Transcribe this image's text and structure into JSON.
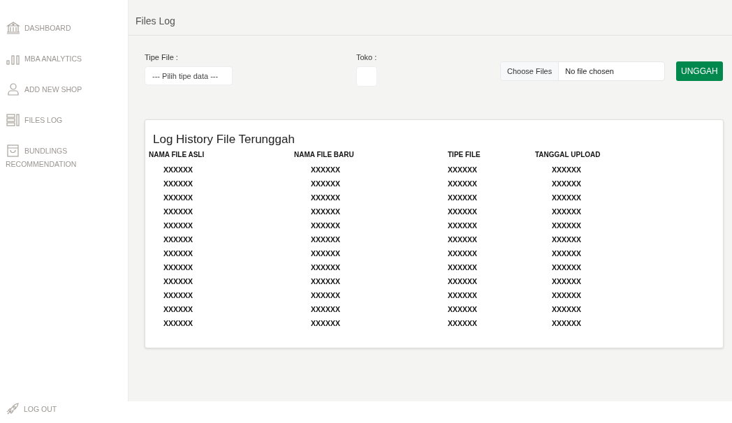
{
  "sidebar": {
    "items": [
      {
        "label": "DASHBOARD"
      },
      {
        "label": "MBA ANALYTICS"
      },
      {
        "label": "ADD NEW SHOP"
      },
      {
        "label": "FILES LOG"
      },
      {
        "label": "BUNDLINGS",
        "continuation": "RECOMMENDATION"
      }
    ],
    "logout": {
      "label": "LOG OUT"
    }
  },
  "header": {
    "title": "Files Log"
  },
  "form": {
    "tipe_file": {
      "label": "Tipe File :",
      "placeholder": "--- Pilih tipe data ---"
    },
    "toko": {
      "label": "Toko :"
    },
    "file_input": {
      "button": "Choose Files",
      "status": "No file chosen"
    },
    "upload_button": "UNGGAH"
  },
  "table": {
    "title": "Log History File Terunggah",
    "columns": [
      "NAMA FILE ASLI",
      "NAMA FILE BARU",
      "TIPE FILE",
      "TANGGAL UPLOAD"
    ],
    "rows": [
      [
        "XXXXXX",
        "XXXXXX",
        "XXXXXX",
        "XXXXXX"
      ],
      [
        "XXXXXX",
        "XXXXXX",
        "XXXXXX",
        "XXXXXX"
      ],
      [
        "XXXXXX",
        "XXXXXX",
        "XXXXXX",
        "XXXXXX"
      ],
      [
        "XXXXXX",
        "XXXXXX",
        "XXXXXX",
        "XXXXXX"
      ],
      [
        "XXXXXX",
        "XXXXXX",
        "XXXXXX",
        "XXXXXX"
      ],
      [
        "XXXXXX",
        "XXXXXX",
        "XXXXXX",
        "XXXXXX"
      ],
      [
        "XXXXXX",
        "XXXXXX",
        "XXXXXX",
        "XXXXXX"
      ],
      [
        "XXXXXX",
        "XXXXXX",
        "XXXXXX",
        "XXXXXX"
      ],
      [
        "XXXXXX",
        "XXXXXX",
        "XXXXXX",
        "XXXXXX"
      ],
      [
        "XXXXXX",
        "XXXXXX",
        "XXXXXX",
        "XXXXXX"
      ],
      [
        "XXXXXX",
        "XXXXXX",
        "XXXXXX",
        "XXXXXX"
      ],
      [
        "XXXXXX",
        "XXXXXX",
        "XXXXXX",
        "XXXXXX"
      ]
    ]
  }
}
